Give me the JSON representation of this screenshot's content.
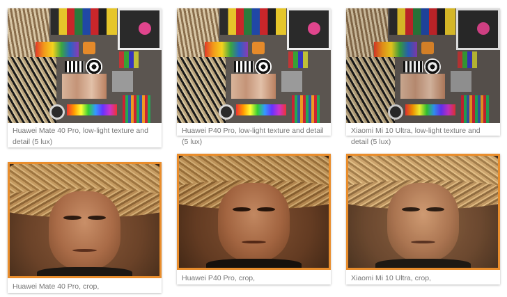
{
  "gallery": {
    "accent_color": "#e98d2c",
    "items": [
      {
        "caption": "Huawei Mate 40 Pro, low-light texture and detail (5 lux)",
        "scene": "art-supplies",
        "highlighted": false
      },
      {
        "caption": "Huawei P40 Pro, low-light texture and detail (5 lux)",
        "scene": "art-supplies",
        "highlighted": false
      },
      {
        "caption": "Xiaomi Mi 10 Ultra, low-light texture and detail (5 lux)",
        "scene": "art-supplies",
        "highlighted": false
      },
      {
        "caption": "Huawei Mate 40 Pro, crop,",
        "scene": "portrait-crop",
        "highlighted": true
      },
      {
        "caption": "Huawei P40 Pro, crop,",
        "scene": "portrait-crop",
        "highlighted": true
      },
      {
        "caption": "Xiaomi Mi 10 Ultra, crop,",
        "scene": "portrait-crop",
        "highlighted": true
      }
    ]
  }
}
